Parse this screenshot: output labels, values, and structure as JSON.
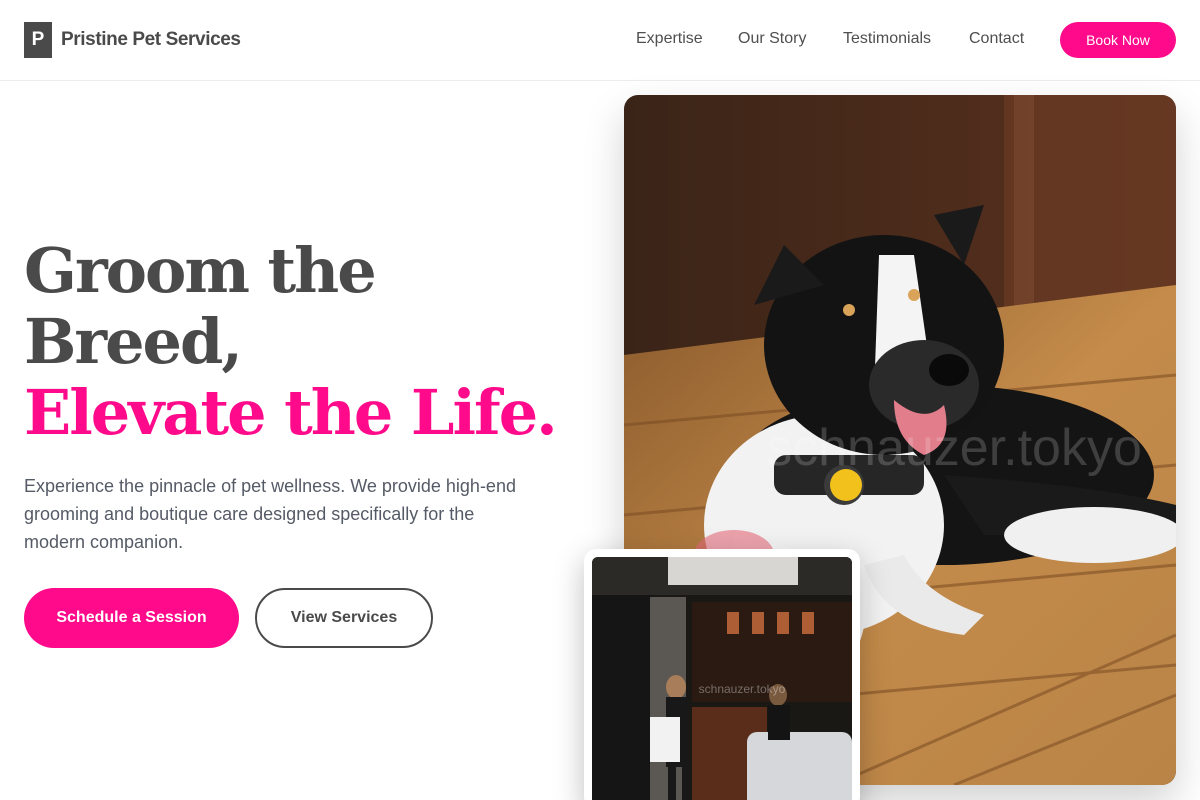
{
  "brand": {
    "logo_letter": "P",
    "name": "Pristine Pet Services"
  },
  "nav": {
    "items": [
      {
        "label": "Expertise"
      },
      {
        "label": "Our Story"
      },
      {
        "label": "Testimonials"
      },
      {
        "label": "Contact"
      }
    ],
    "cta_label": "Book Now"
  },
  "hero": {
    "headline_line1": "Groom the",
    "headline_line2": "Breed,",
    "headline_accent": "Elevate the Life.",
    "lead": "Experience the pinnacle of pet wellness. We provide high-end grooming and boutique care designed specifically for the modern companion.",
    "primary_cta": "Schedule a Session",
    "secondary_cta": "View Services"
  },
  "images": {
    "main_watermark": "schnauzer.tokyo",
    "small_watermark": "schnauzer.tokyo"
  },
  "colors": {
    "accent": "#ff0a8a",
    "text_dark": "#4a4a4a",
    "text_body": "#555b66"
  }
}
